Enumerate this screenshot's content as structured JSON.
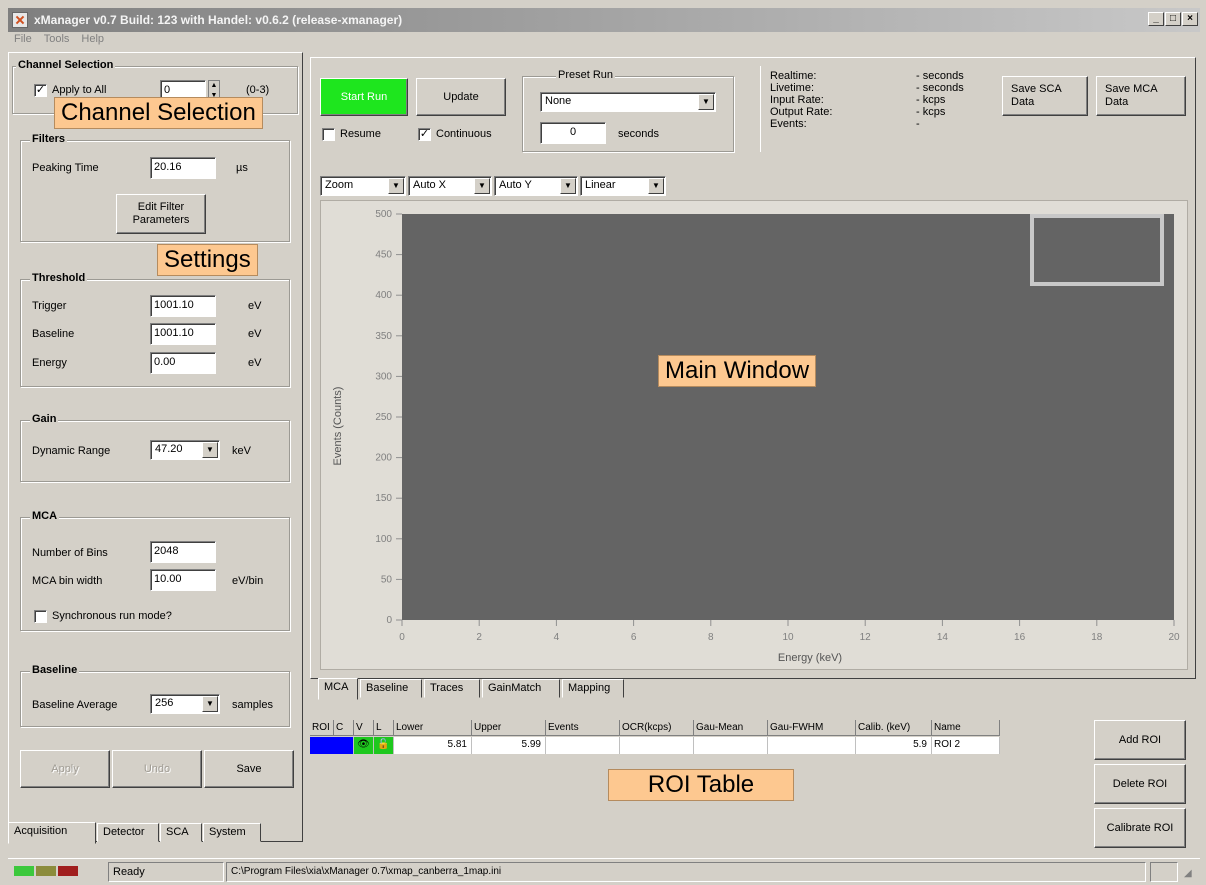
{
  "window": {
    "title": "xManager v0.7 Build: 123 with Handel: v0.6.2 (release-xmanager)",
    "minimize": "_",
    "maximize": "□",
    "close": "×"
  },
  "menu": [
    "File",
    "Tools",
    "Help"
  ],
  "channel_selection": {
    "title": "Channel Selection",
    "apply_all_label": "Apply to All",
    "apply_all_checked": true,
    "channel_value": "0",
    "range_text": "(0-3)"
  },
  "filters": {
    "title": "Filters",
    "peaking_time_label": "Peaking Time",
    "peaking_time_value": "20.16",
    "peaking_time_unit": "µs",
    "edit_button": "Edit Filter Parameters"
  },
  "threshold": {
    "title": "Threshold",
    "rows": [
      {
        "label": "Trigger",
        "value": "1001.10",
        "unit": "eV"
      },
      {
        "label": "Baseline",
        "value": "1001.10",
        "unit": "eV"
      },
      {
        "label": "Energy",
        "value": "0.00",
        "unit": "eV"
      }
    ]
  },
  "gain": {
    "title": "Gain",
    "dynamic_range_label": "Dynamic Range",
    "dynamic_range_value": "47.20",
    "dynamic_range_unit": "keV"
  },
  "mca": {
    "title": "MCA",
    "bins_label": "Number of Bins",
    "bins_value": "2048",
    "bin_width_label": "MCA bin width",
    "bin_width_value": "10.00",
    "bin_width_unit": "eV/bin",
    "sync_label": "Synchronous run mode?",
    "sync_checked": false
  },
  "baseline_group": {
    "title": "Baseline",
    "avg_label": "Baseline Average",
    "avg_value": "256",
    "avg_unit": "samples"
  },
  "left_buttons": {
    "apply": "Apply",
    "undo": "Undo",
    "save": "Save"
  },
  "left_tabs": [
    "Acquisition",
    "Detector",
    "SCA",
    "System"
  ],
  "run": {
    "start_button": "Start Run",
    "update_button": "Update",
    "resume_label": "Resume",
    "resume_checked": false,
    "continuous_label": "Continuous",
    "continuous_checked": true
  },
  "preset_run": {
    "title": "Preset Run",
    "mode_value": "None",
    "seconds_value": "0",
    "seconds_label": "seconds"
  },
  "stats": [
    {
      "label": "Realtime:",
      "value": "- seconds"
    },
    {
      "label": "Livetime:",
      "value": "- seconds"
    },
    {
      "label": "Input Rate:",
      "value": "- kcps"
    },
    {
      "label": "Output Rate:",
      "value": "- kcps"
    },
    {
      "label": "Events:",
      "value": "-"
    }
  ],
  "save_buttons": {
    "sca": "Save SCA Data",
    "mca": "Save MCA Data"
  },
  "plot_controls": {
    "zoom": "Zoom",
    "auto_x": "Auto X",
    "auto_y": "Auto Y",
    "scale": "Linear"
  },
  "chart_data": {
    "type": "line",
    "xlabel": "Energy (keV)",
    "ylabel": "Events (Counts)",
    "xlim": [
      0,
      20
    ],
    "ylim": [
      0,
      500
    ],
    "x_ticks": [
      0,
      2,
      4,
      6,
      8,
      10,
      12,
      14,
      16,
      18,
      20
    ],
    "y_ticks": [
      0,
      50,
      100,
      150,
      200,
      250,
      300,
      350,
      400,
      450,
      500
    ],
    "series": [],
    "background": "#646464"
  },
  "plot_tabs": [
    "MCA",
    "Baseline",
    "Traces",
    "GainMatch",
    "Mapping"
  ],
  "roi_table": {
    "columns": [
      "ROI",
      "C",
      "V",
      "L",
      "Lower",
      "Upper",
      "Events",
      "OCR(kcps)",
      "Gau-Mean",
      "Gau-FWHM",
      "Calib. (keV)",
      "Name"
    ],
    "rows": [
      {
        "lower": "5.81",
        "upper": "5.99",
        "events": "",
        "ocr": "",
        "gau_mean": "",
        "gau_fwhm": "",
        "calib": "5.9",
        "name": "ROI 2",
        "color": "#0000ff"
      }
    ]
  },
  "roi_buttons": {
    "add": "Add ROI",
    "delete": "Delete ROI",
    "calibrate": "Calibrate ROI"
  },
  "status": {
    "text": "Ready",
    "path": "C:\\Program Files\\xia\\xManager 0.7\\xmap_canberra_1map.ini",
    "leds": [
      "#3cc83c",
      "#8c8c3c",
      "#a01e1e"
    ]
  },
  "callouts": {
    "channel_selection": "Channel Selection",
    "settings": "Settings",
    "main_window": "Main Window",
    "roi_table": "ROI Table"
  }
}
